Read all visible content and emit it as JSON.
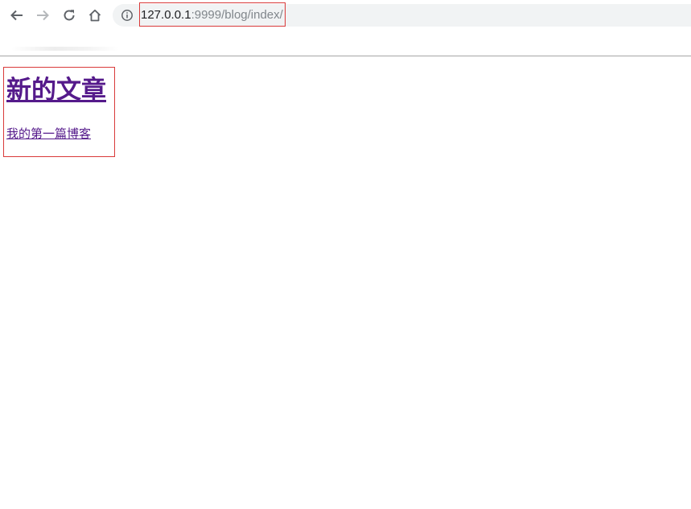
{
  "browser": {
    "address_bar": {
      "host": "127.0.0.1",
      "path": ":9999/blog/index/"
    },
    "colors": {
      "highlight_border": "#d93a3a",
      "visited_link": "#551a8b",
      "omnibox_bg": "#f1f3f4"
    },
    "icons": {
      "back": "arrow-left-icon",
      "forward": "arrow-right-icon",
      "reload": "reload-icon",
      "home": "home-icon",
      "site_info": "info-icon"
    }
  },
  "page": {
    "heading": "新的文章",
    "articles": [
      {
        "title": "我的第一篇博客"
      }
    ]
  }
}
